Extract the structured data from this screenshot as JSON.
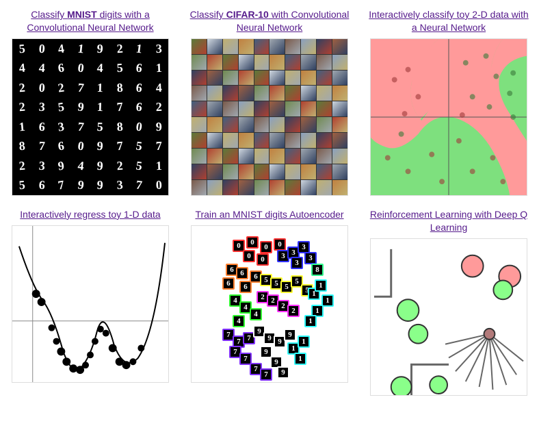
{
  "cards": [
    {
      "title_pre": "Classify ",
      "title_bold": "MNIST",
      "title_post": " digits with a Convolutional Neural Network"
    },
    {
      "title_pre": "Classify ",
      "title_bold": "CIFAR-10",
      "title_post": " with Convolutional Neural Network"
    },
    {
      "title_pre": "",
      "title_bold": "",
      "title_post": "Interactively classify toy 2-D data with a Neural Network"
    },
    {
      "title_pre": "",
      "title_bold": "",
      "title_post": "Interactively regress toy 1-D data"
    },
    {
      "title_pre": "",
      "title_bold": "",
      "title_post": "Train an MNIST digits Autoencoder"
    },
    {
      "title_pre": "",
      "title_bold": "",
      "title_post": "Reinforcement Learning with Deep Q Learning"
    }
  ],
  "mnist_digits": [
    "5",
    "0",
    "4",
    "1",
    "9",
    "2",
    "1",
    "3",
    "4",
    "4",
    "6",
    "0",
    "4",
    "5",
    "6",
    "1",
    "2",
    "0",
    "2",
    "7",
    "1",
    "8",
    "6",
    "4",
    "2",
    "3",
    "5",
    "9",
    "1",
    "7",
    "6",
    "2",
    "1",
    "6",
    "3",
    "7",
    "5",
    "8",
    "0",
    "9",
    "8",
    "7",
    "6",
    "0",
    "9",
    "7",
    "5",
    "7",
    "2",
    "3",
    "9",
    "4",
    "9",
    "2",
    "5",
    "1",
    "5",
    "6",
    "7",
    "9",
    "9",
    "3",
    "7",
    "0"
  ]
}
